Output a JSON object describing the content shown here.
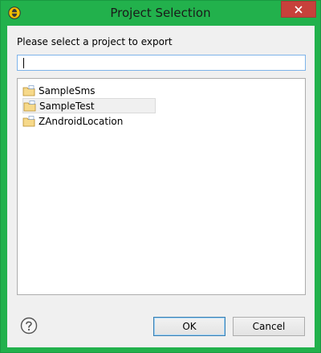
{
  "window": {
    "title": "Project Selection"
  },
  "dialog": {
    "prompt": "Please select a project to export",
    "search": {
      "value": "",
      "placeholder": ""
    },
    "projects": [
      {
        "label": "SampleSms",
        "selected": false
      },
      {
        "label": "SampleTest",
        "selected": true
      },
      {
        "label": "ZAndroidLocation",
        "selected": false
      }
    ],
    "ok_label": "OK",
    "cancel_label": "Cancel"
  },
  "icons": {
    "app": "eclipse-icon",
    "close": "close-icon",
    "project": "project-folder-icon",
    "help": "help-icon"
  },
  "colors": {
    "frame": "#22b14c",
    "close": "#c7413b",
    "focus": "#7eb4ea"
  }
}
